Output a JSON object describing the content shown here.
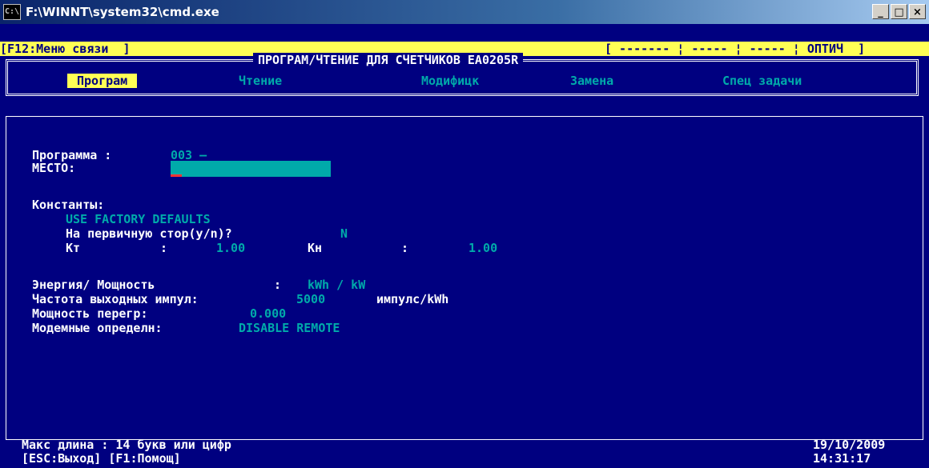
{
  "window": {
    "title": "F:\\WINNT\\system32\\cmd.exe",
    "buttons": {
      "minimize": "_",
      "maximize": "□",
      "close": "×"
    },
    "icon_text": "C:\\"
  },
  "status_bar": {
    "left": "[F12:Меню связи  ]",
    "right": "[ ------- ¦ ----- ¦ ----- ¦ ОПТИЧ  ]"
  },
  "menu": {
    "title": "ПРОГРАМ/ЧТЕНИЕ ДЛЯ СЧЕТЧИКОВ EA0205R",
    "items": [
      {
        "label": "Програм",
        "active": true
      },
      {
        "label": "Чтение",
        "active": false
      },
      {
        "label": "Модифицк",
        "active": false
      },
      {
        "label": "Замена",
        "active": false
      },
      {
        "label": "Спец задачи",
        "active": false
      }
    ]
  },
  "form": {
    "program_label": "Программа :",
    "program_value": "003 –",
    "place_label": "МЕСТО:",
    "place_value": "",
    "constants_label": "Константы:",
    "factory_defaults": "USE FACTORY DEFAULTS",
    "primary_side_label": "На первичную стор(y/n)?",
    "primary_side_value": "N",
    "kt_label": "Кт",
    "kt_sep": ":",
    "kt_value": "1.00",
    "kn_label": "Кн",
    "kn_sep": ":",
    "kn_value": "1.00",
    "energy_label": "Энергия/ Мощность",
    "energy_sep": ":",
    "energy_value": "kWh / kW",
    "freq_label": "Частота выходных импул:",
    "freq_value": "5000",
    "freq_unit": "импулс/kWh",
    "overload_label": "Мощность перегр:",
    "overload_value": "0.000",
    "modem_label": "Модемные определн:",
    "modem_value": "DISABLE REMOTE"
  },
  "footer": {
    "hint": "Макс длина : 14 букв или цифр",
    "keys": "[ESC:Выход] [F1:Помощ]",
    "date": "19/10/2009",
    "time": "14:31:17"
  },
  "colors": {
    "background": "#000080",
    "highlight": "#ffff55",
    "value": "#00aaaa",
    "text": "#ffffff"
  }
}
